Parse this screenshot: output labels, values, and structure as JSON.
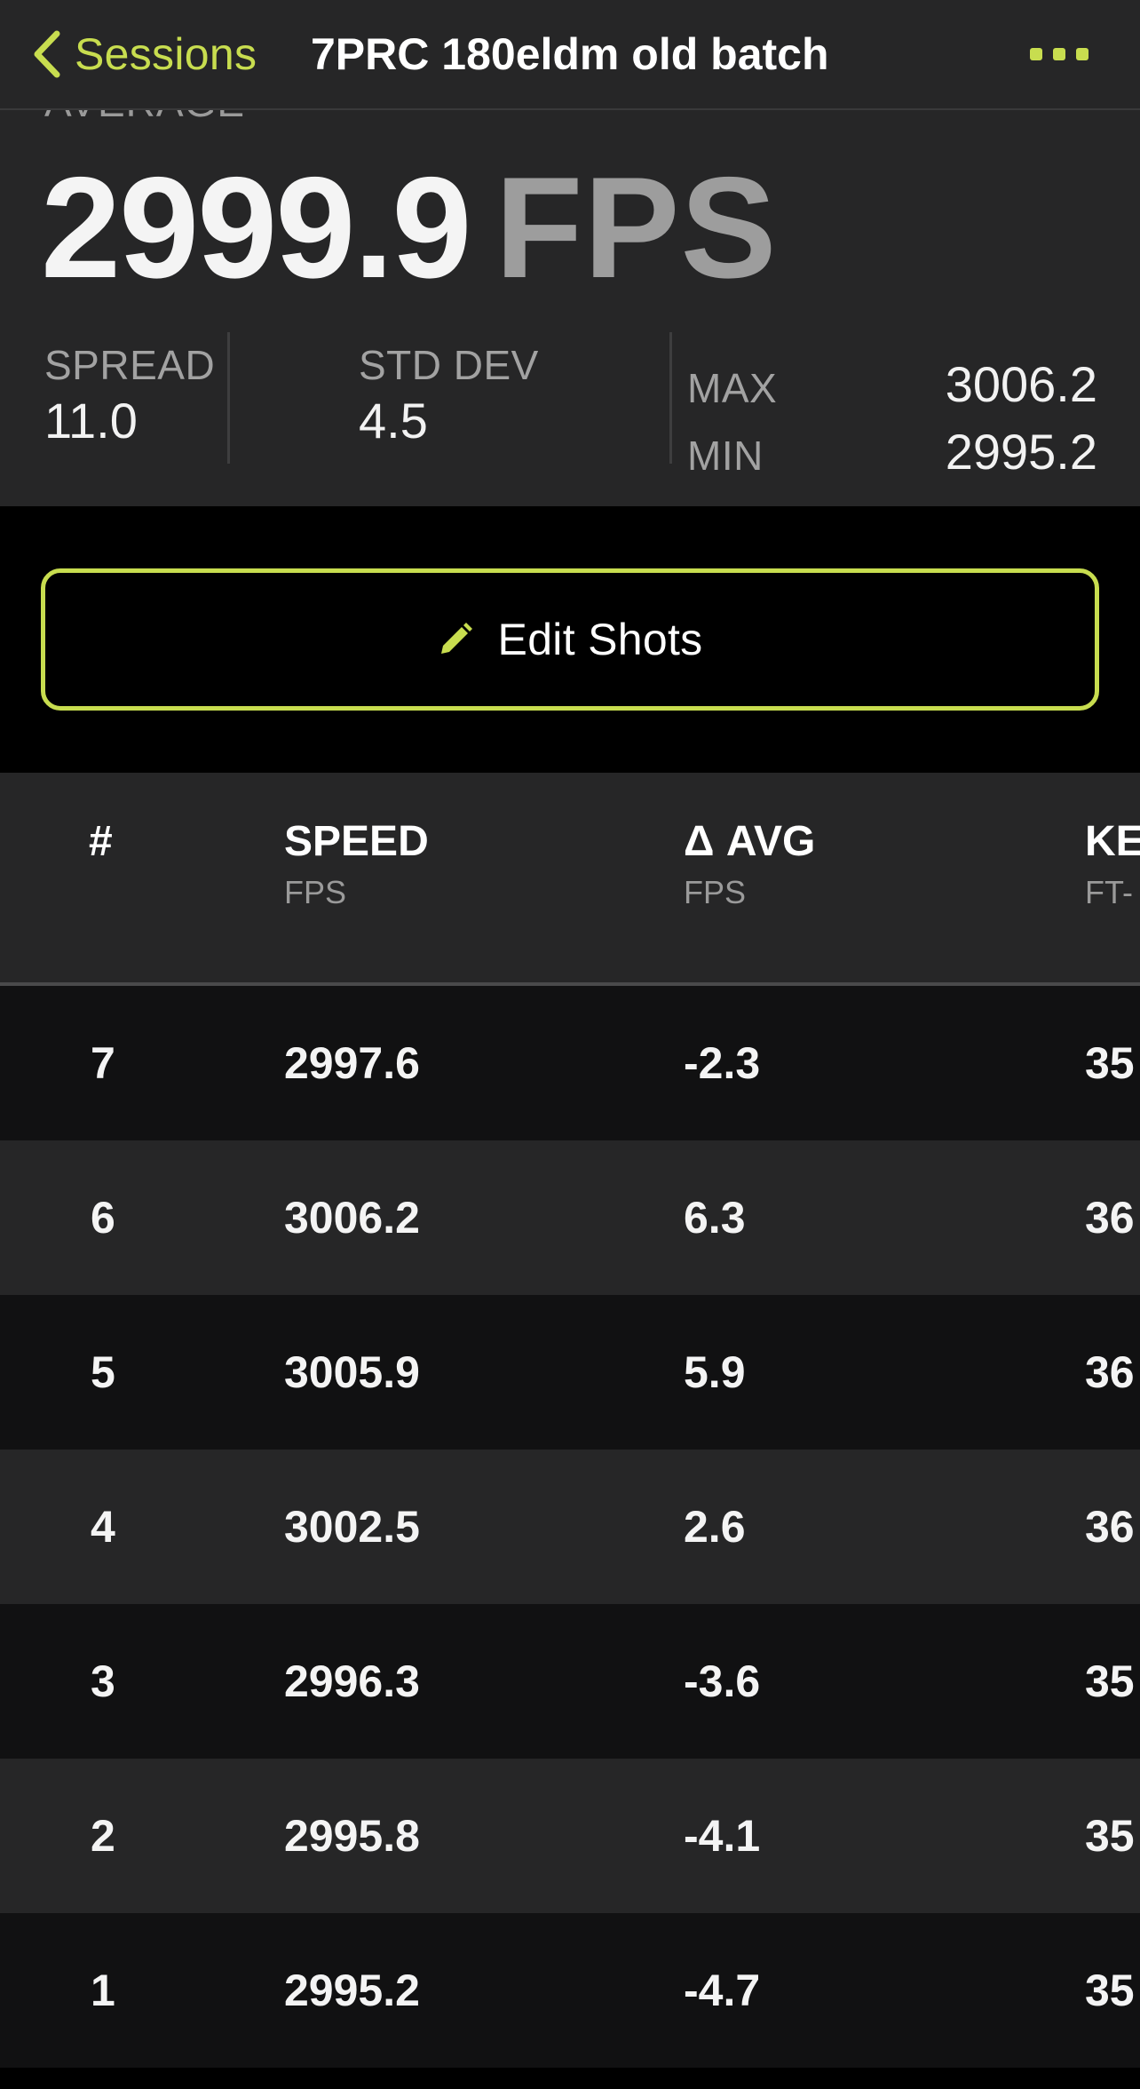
{
  "nav": {
    "back_label": "Sessions",
    "title": "7PRC 180eldm old batch",
    "accent_color": "#c8dd4f"
  },
  "summary": {
    "average_label": "AVERAGE",
    "average_value": "2999.9",
    "average_unit": "FPS",
    "spread_label": "SPREAD",
    "spread_value": "11.0",
    "std_dev_label": "STD DEV",
    "std_dev_value": "4.5",
    "max_label": "MAX",
    "max_value": "3006.2",
    "min_label": "MIN",
    "min_value": "2995.2"
  },
  "edit_button": {
    "label": "Edit Shots",
    "icon": "pencil-icon"
  },
  "table": {
    "columns": [
      {
        "title": "#",
        "unit": ""
      },
      {
        "title": "SPEED",
        "unit": "FPS"
      },
      {
        "title": "Δ AVG",
        "unit": "FPS"
      },
      {
        "title": "KE",
        "unit": "FT-"
      }
    ],
    "rows": [
      {
        "num": "7",
        "speed": "2997.6",
        "delta": "-2.3",
        "ke": "35"
      },
      {
        "num": "6",
        "speed": "3006.2",
        "delta": "6.3",
        "ke": "36"
      },
      {
        "num": "5",
        "speed": "3005.9",
        "delta": "5.9",
        "ke": "36"
      },
      {
        "num": "4",
        "speed": "3002.5",
        "delta": "2.6",
        "ke": "36"
      },
      {
        "num": "3",
        "speed": "2996.3",
        "delta": "-3.6",
        "ke": "35"
      },
      {
        "num": "2",
        "speed": "2995.8",
        "delta": "-4.1",
        "ke": "35"
      },
      {
        "num": "1",
        "speed": "2995.2",
        "delta": "-4.7",
        "ke": "35"
      }
    ]
  }
}
